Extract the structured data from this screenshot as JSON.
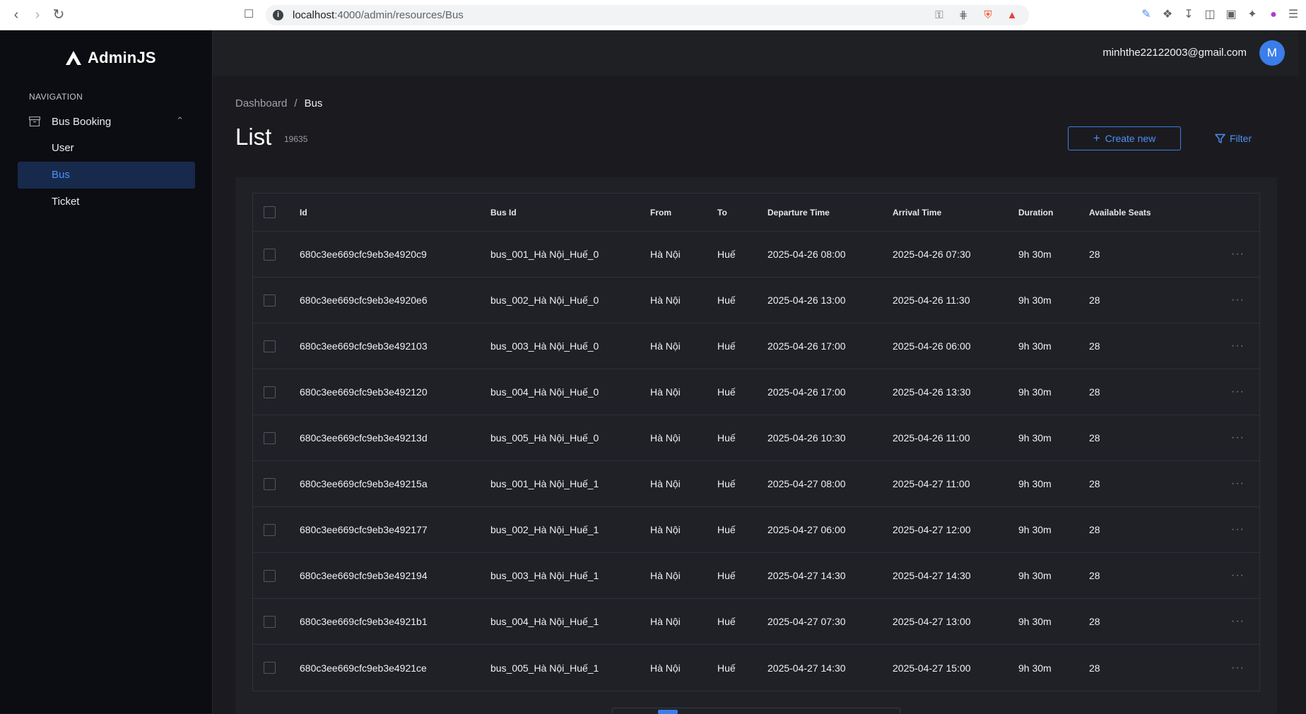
{
  "browser": {
    "url_host": "localhost",
    "url_rest": ":4000/admin/resources/Bus"
  },
  "app": {
    "logo_text": "AdminJS",
    "nav_heading": "NAVIGATION",
    "nav_group": "Bus Booking",
    "nav_items": [
      {
        "label": "User"
      },
      {
        "label": "Bus"
      },
      {
        "label": "Ticket"
      }
    ],
    "active_item": "Bus"
  },
  "header": {
    "user_email": "minhthe22122003@gmail.com",
    "avatar_initial": "M"
  },
  "page": {
    "breadcrumb": [
      "Dashboard",
      "Bus"
    ],
    "breadcrumb_sep": "/",
    "title": "List",
    "count": "19635",
    "create_label": "Create new",
    "filter_label": "Filter"
  },
  "table": {
    "columns": [
      "Id",
      "Bus Id",
      "From",
      "To",
      "Departure Time",
      "Arrival Time",
      "Duration",
      "Available Seats"
    ],
    "rows": [
      [
        "680c3ee669cfc9eb3e4920c9",
        "bus_001_Hà Nội_Huế_0",
        "Hà Nội",
        "Huế",
        "2025-04-26 08:00",
        "2025-04-26 07:30",
        "9h 30m",
        "28"
      ],
      [
        "680c3ee669cfc9eb3e4920e6",
        "bus_002_Hà Nội_Huế_0",
        "Hà Nội",
        "Huế",
        "2025-04-26 13:00",
        "2025-04-26 11:30",
        "9h 30m",
        "28"
      ],
      [
        "680c3ee669cfc9eb3e492103",
        "bus_003_Hà Nội_Huế_0",
        "Hà Nội",
        "Huế",
        "2025-04-26 17:00",
        "2025-04-26 06:00",
        "9h 30m",
        "28"
      ],
      [
        "680c3ee669cfc9eb3e492120",
        "bus_004_Hà Nội_Huế_0",
        "Hà Nội",
        "Huế",
        "2025-04-26 17:00",
        "2025-04-26 13:30",
        "9h 30m",
        "28"
      ],
      [
        "680c3ee669cfc9eb3e49213d",
        "bus_005_Hà Nội_Huế_0",
        "Hà Nội",
        "Huế",
        "2025-04-26 10:30",
        "2025-04-26 11:00",
        "9h 30m",
        "28"
      ],
      [
        "680c3ee669cfc9eb3e49215a",
        "bus_001_Hà Nội_Huế_1",
        "Hà Nội",
        "Huế",
        "2025-04-27 08:00",
        "2025-04-27 11:00",
        "9h 30m",
        "28"
      ],
      [
        "680c3ee669cfc9eb3e492177",
        "bus_002_Hà Nội_Huế_1",
        "Hà Nội",
        "Huế",
        "2025-04-27 06:00",
        "2025-04-27 12:00",
        "9h 30m",
        "28"
      ],
      [
        "680c3ee669cfc9eb3e492194",
        "bus_003_Hà Nội_Huế_1",
        "Hà Nội",
        "Huế",
        "2025-04-27 14:30",
        "2025-04-27 14:30",
        "9h 30m",
        "28"
      ],
      [
        "680c3ee669cfc9eb3e4921b1",
        "bus_004_Hà Nội_Huế_1",
        "Hà Nội",
        "Huế",
        "2025-04-27 07:30",
        "2025-04-27 13:00",
        "9h 30m",
        "28"
      ],
      [
        "680c3ee669cfc9eb3e4921ce",
        "bus_005_Hà Nội_Huế_1",
        "Hà Nội",
        "Huế",
        "2025-04-27 14:30",
        "2025-04-27 15:00",
        "9h 30m",
        "28"
      ]
    ]
  },
  "colors": {
    "accent": "#3b7de9",
    "sidebar_bg": "#0c0d12",
    "main_bg": "#1b1b1f"
  }
}
